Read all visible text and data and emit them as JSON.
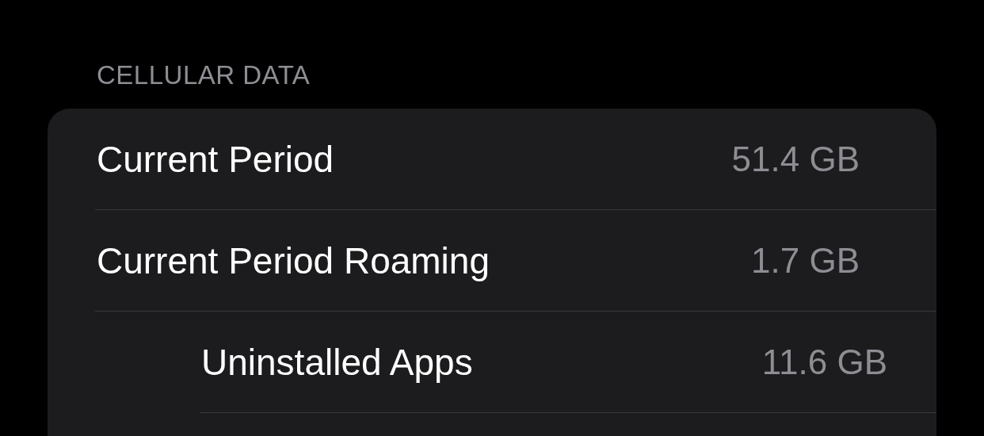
{
  "section_header": "CELLULAR DATA",
  "rows": [
    {
      "label": "Current Period",
      "value": "51.4 GB"
    },
    {
      "label": "Current Period Roaming",
      "value": "1.7 GB",
      "children": [
        {
          "label": "Uninstalled Apps",
          "value": "11.6 GB"
        }
      ]
    }
  ]
}
